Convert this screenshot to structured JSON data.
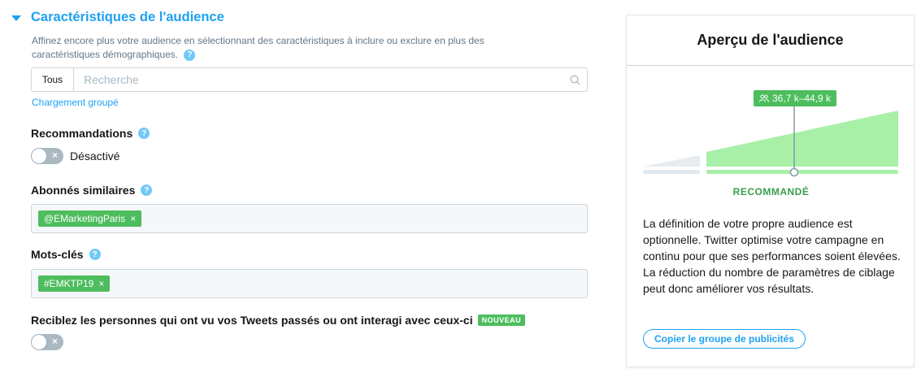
{
  "section": {
    "title": "Caractéristiques de l'audience",
    "description": "Affinez encore plus votre audience en sélectionnant des caractéristiques à inclure ou exclure en plus des caractéristiques démographiques.",
    "help_glyph": "?"
  },
  "search": {
    "scope": "Tous",
    "placeholder": "Recherche",
    "value": ""
  },
  "bulk_upload_link": "Chargement groupé",
  "recommendations": {
    "label": "Recommandations",
    "toggle_state": "Désactivé",
    "toggle_on": false
  },
  "similar_followers": {
    "label": "Abonnés similaires",
    "tags": [
      "@EMarketingParis"
    ]
  },
  "keywords": {
    "label": "Mots-clés",
    "tags": [
      "#EMKTP19"
    ]
  },
  "retarget": {
    "label": "Reciblez les personnes qui ont vu vos Tweets passés ou ont interagi avec ceux-ci",
    "badge": "NOUVEAU",
    "toggle_on": false
  },
  "preview": {
    "title": "Aperçu de l'audience",
    "range": "36,7 k–44,9 k",
    "recommended_label": "RECOMMANDÉ",
    "text": "La définition de votre propre audience est optionnelle. Twitter optimise votre campagne en continu pour que ses performances soient élevées. La réduction du nombre de paramètres de ciblage peut donc améliorer vos résultats.",
    "copy_button": "Copier le groupe de publicités"
  },
  "icons": {
    "close": "×",
    "people": "people-icon"
  },
  "colors": {
    "accent": "#1da1f2",
    "tag_green": "#4dbd5d",
    "chart_green": "#a8f0a8",
    "recommend_green": "#3a9e4a"
  }
}
